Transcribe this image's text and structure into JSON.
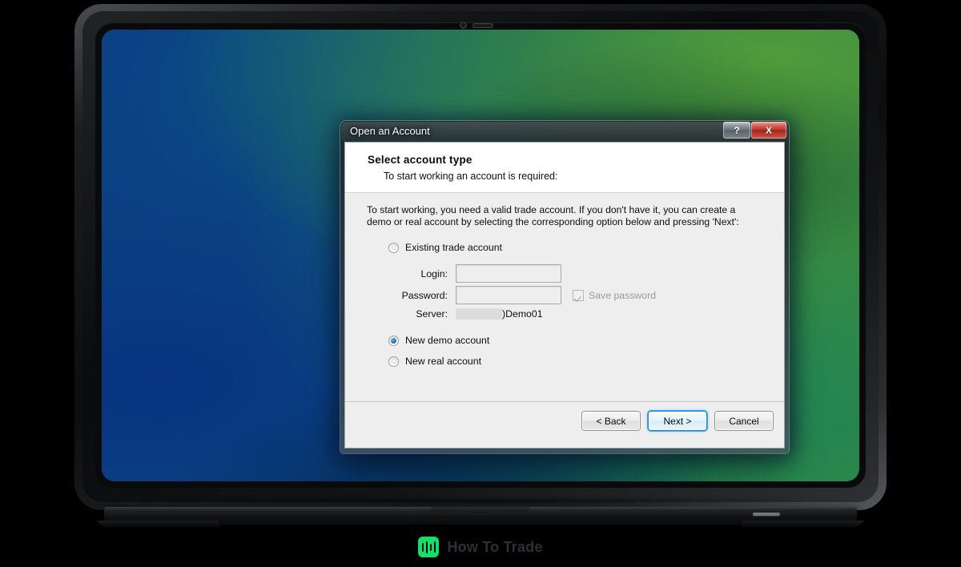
{
  "watermark": {
    "brand": "How To Trade",
    "logo_icon": "bar-chart-logo-icon",
    "logo_color": "#12e06b"
  },
  "desktop": {
    "wallpaper_colors": [
      "#0b3f85",
      "#0a5f82",
      "#10736e",
      "#2e8b45"
    ]
  },
  "device": {
    "type": "laptop",
    "webcam_icon": "webcam-icon",
    "microphone_icon": "microphone-icon"
  },
  "dialog": {
    "title": "Open an Account",
    "window_buttons": {
      "help_label": "?",
      "help_icon": "help-icon",
      "close_label": "X",
      "close_icon": "close-icon",
      "close_color": "#c23b30"
    },
    "header": {
      "title": "Select account type",
      "subtitle": "To start working an account is required:"
    },
    "intro_text": "To start working, you need a valid trade account. If you don't have it, you can create a demo or real account by selecting the corresponding option below and pressing 'Next':",
    "options": [
      {
        "id": "existing",
        "label": "Existing trade account",
        "selected": false
      },
      {
        "id": "demo",
        "label": "New demo account",
        "selected": true
      },
      {
        "id": "real",
        "label": "New real account",
        "selected": false
      }
    ],
    "fields": {
      "login": {
        "label": "Login:",
        "value": "",
        "placeholder": ""
      },
      "password": {
        "label": "Password:",
        "value": "",
        "placeholder": ""
      },
      "server": {
        "label": "Server:",
        "value": ")Demo01",
        "redacted": true
      },
      "save_password": {
        "label": "Save password",
        "checked": true,
        "enabled": false
      }
    },
    "buttons": {
      "back": "< Back",
      "next": "Next >",
      "cancel": "Cancel",
      "focused": "next",
      "focus_color": "#3aa8e8"
    }
  }
}
